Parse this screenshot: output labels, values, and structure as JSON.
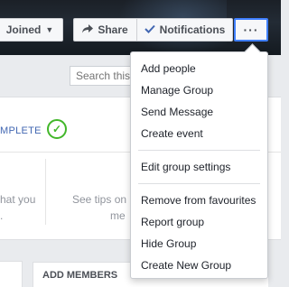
{
  "header": {
    "joined_label": "Joined",
    "share_label": "Share",
    "notifications_label": "Notifications",
    "more_label": "···"
  },
  "search": {
    "placeholder": "Search this"
  },
  "progress": {
    "complete_label": "MPLETE"
  },
  "tips": {
    "left_line1": "hat you",
    "left_line2": ".",
    "right_line1": "See tips on",
    "right_line2": "me"
  },
  "add_members": {
    "label": "ADD MEMBERS"
  },
  "menu": {
    "group1": [
      "Add people",
      "Manage Group",
      "Send Message",
      "Create event"
    ],
    "group2": [
      "Edit group settings"
    ],
    "group3": [
      "Remove from favourites",
      "Report group",
      "Hide Group",
      "Create New Group"
    ]
  }
}
